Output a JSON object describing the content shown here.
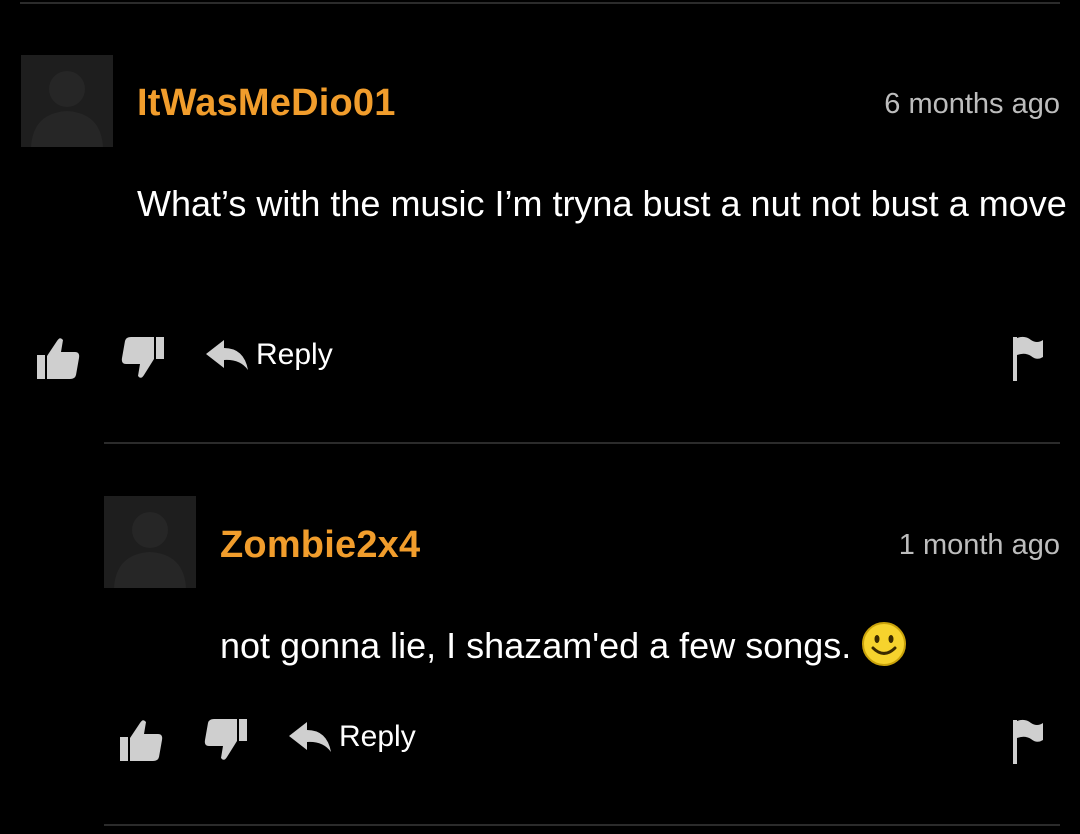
{
  "comments": [
    {
      "username": "ItWasMeDio01",
      "timestamp": "6 months ago",
      "text": "What’s with the music I’m tryna bust a nut not bust a move",
      "reply_label": "Reply",
      "emoji": null
    },
    {
      "username": "Zombie2x4",
      "timestamp": "1 month ago",
      "text": "not gonna lie, I shazam'ed a few songs.",
      "reply_label": "Reply",
      "emoji": "smiley-face-icon"
    }
  ],
  "colors": {
    "background": "#000000",
    "username": "#f19d2c",
    "timestamp": "#bdbdbd",
    "text": "#ffffff",
    "icon": "#cfcfcf",
    "divider": "#2b2b2b"
  }
}
